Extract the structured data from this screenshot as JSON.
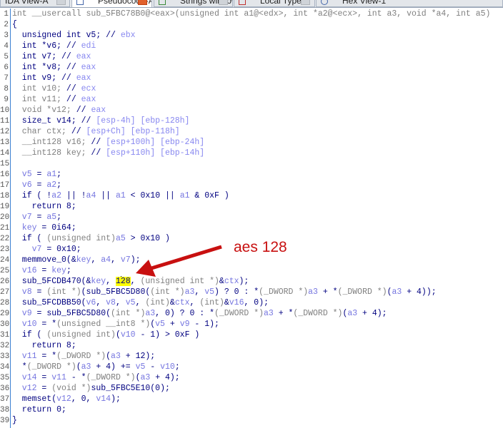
{
  "tabs": [
    {
      "label": "IDA View-A",
      "active": false
    },
    {
      "label": "Pseudocode-A",
      "active": true
    },
    {
      "label": "Strings window",
      "active": false
    },
    {
      "label": "Local Types",
      "active": false
    },
    {
      "label": "Hex View-1",
      "active": false
    }
  ],
  "annotation": {
    "label": "aes 128",
    "color": "#c81010"
  },
  "code": [
    [
      [
        "g",
        "int __usercall sub_5FBC78B0@<eax>(unsigned int a1@<edx>, int *a2@<ecx>, int a3, void *a4, int a5)"
      ]
    ],
    [
      [
        "k",
        "{"
      ]
    ],
    [
      [
        "k",
        "  unsigned int v5; // "
      ],
      [
        "c",
        "ebx"
      ]
    ],
    [
      [
        "k",
        "  int *v6; // "
      ],
      [
        "c",
        "edi"
      ]
    ],
    [
      [
        "k",
        "  int v7; // "
      ],
      [
        "c",
        "eax"
      ]
    ],
    [
      [
        "k",
        "  int *v8; // "
      ],
      [
        "c",
        "eax"
      ]
    ],
    [
      [
        "k",
        "  int v9; // "
      ],
      [
        "c",
        "eax"
      ]
    ],
    [
      [
        "g",
        "  int v10; "
      ],
      [
        "k",
        "// "
      ],
      [
        "c",
        "ecx"
      ]
    ],
    [
      [
        "g",
        "  int v11; "
      ],
      [
        "k",
        "// "
      ],
      [
        "c",
        "eax"
      ]
    ],
    [
      [
        "g",
        "  void *v12; "
      ],
      [
        "k",
        "// "
      ],
      [
        "c",
        "eax"
      ]
    ],
    [
      [
        "k",
        "  size_t v14; // "
      ],
      [
        "c",
        "[esp-4h] [ebp-128h]"
      ]
    ],
    [
      [
        "g",
        "  char ctx; "
      ],
      [
        "k",
        "// "
      ],
      [
        "c",
        "[esp+Ch] [ebp-118h]"
      ]
    ],
    [
      [
        "g",
        "  __int128 v16; "
      ],
      [
        "k",
        "// "
      ],
      [
        "c",
        "[esp+100h] [ebp-24h]"
      ]
    ],
    [
      [
        "g",
        "  __int128 key; "
      ],
      [
        "k",
        "// "
      ],
      [
        "c",
        "[esp+110h] [ebp-14h]"
      ]
    ],
    [],
    [
      [
        "v",
        "  v5"
      ],
      [
        "k",
        " = "
      ],
      [
        "v",
        "a1"
      ],
      [
        "k",
        ";"
      ]
    ],
    [
      [
        "v",
        "  v6"
      ],
      [
        "k",
        " = "
      ],
      [
        "v",
        "a2"
      ],
      [
        "k",
        ";"
      ]
    ],
    [
      [
        "k",
        "  if ( !"
      ],
      [
        "v",
        "a2"
      ],
      [
        "k",
        " || !"
      ],
      [
        "v",
        "a4"
      ],
      [
        "k",
        " || "
      ],
      [
        "v",
        "a1"
      ],
      [
        "k",
        " < 0x10 || "
      ],
      [
        "v",
        "a1"
      ],
      [
        "k",
        " & 0xF )"
      ]
    ],
    [
      [
        "k",
        "    return 8;"
      ]
    ],
    [
      [
        "v",
        "  v7"
      ],
      [
        "k",
        " = "
      ],
      [
        "v",
        "a5"
      ],
      [
        "k",
        ";"
      ]
    ],
    [
      [
        "v",
        "  key"
      ],
      [
        "k",
        " = 0i64;"
      ]
    ],
    [
      [
        "k",
        "  if ( "
      ],
      [
        "g",
        "(unsigned int)"
      ],
      [
        "v",
        "a5"
      ],
      [
        "k",
        " > 0x10 )"
      ]
    ],
    [
      [
        "v",
        "    v7"
      ],
      [
        "k",
        " = 0x10;"
      ]
    ],
    [
      [
        "k",
        "  memmove_0(&"
      ],
      [
        "v",
        "key"
      ],
      [
        "k",
        ", "
      ],
      [
        "v",
        "a4"
      ],
      [
        "k",
        ", "
      ],
      [
        "v",
        "v7"
      ],
      [
        "k",
        ");"
      ]
    ],
    [
      [
        "v",
        "  v16"
      ],
      [
        "k",
        " = "
      ],
      [
        "v",
        "key"
      ],
      [
        "k",
        ";"
      ]
    ],
    [
      [
        "k",
        "  sub_5FCDB470(&"
      ],
      [
        "v",
        "key"
      ],
      [
        "k",
        ", "
      ],
      [
        "h",
        "1"
      ],
      [
        "cur",
        ""
      ],
      [
        "h",
        "28"
      ],
      [
        "k",
        ", "
      ],
      [
        "g",
        "(unsigned int *)"
      ],
      [
        "k",
        "&"
      ],
      [
        "v",
        "ctx"
      ],
      [
        "k",
        ");"
      ]
    ],
    [
      [
        "v",
        "  v8"
      ],
      [
        "k",
        " = "
      ],
      [
        "g",
        "(int *)"
      ],
      [
        "k",
        "(sub_5FBC5D80("
      ],
      [
        "g",
        "(int *)"
      ],
      [
        "v",
        "a3"
      ],
      [
        "k",
        ", "
      ],
      [
        "v",
        "v5"
      ],
      [
        "k",
        ") ? 0 : *"
      ],
      [
        "g",
        "(_DWORD *)"
      ],
      [
        "v",
        "a3"
      ],
      [
        "k",
        " + *"
      ],
      [
        "g",
        "(_DWORD *)"
      ],
      [
        "k",
        "("
      ],
      [
        "v",
        "a3"
      ],
      [
        "k",
        " + 4));"
      ]
    ],
    [
      [
        "k",
        "  sub_5FCDBB50("
      ],
      [
        "v",
        "v6"
      ],
      [
        "k",
        ", "
      ],
      [
        "v",
        "v8"
      ],
      [
        "k",
        ", "
      ],
      [
        "v",
        "v5"
      ],
      [
        "k",
        ", "
      ],
      [
        "g",
        "(int)"
      ],
      [
        "k",
        "&"
      ],
      [
        "v",
        "ctx"
      ],
      [
        "k",
        ", "
      ],
      [
        "g",
        "(int)"
      ],
      [
        "k",
        "&"
      ],
      [
        "v",
        "v16"
      ],
      [
        "k",
        ", 0);"
      ]
    ],
    [
      [
        "v",
        "  v9"
      ],
      [
        "k",
        " = sub_5FBC5D80("
      ],
      [
        "g",
        "(int *)"
      ],
      [
        "v",
        "a3"
      ],
      [
        "k",
        ", 0) ? 0 : *"
      ],
      [
        "g",
        "(_DWORD *)"
      ],
      [
        "v",
        "a3"
      ],
      [
        "k",
        " + *"
      ],
      [
        "g",
        "(_DWORD *)"
      ],
      [
        "k",
        "("
      ],
      [
        "v",
        "a3"
      ],
      [
        "k",
        " + 4);"
      ]
    ],
    [
      [
        "v",
        "  v10"
      ],
      [
        "k",
        " = *"
      ],
      [
        "g",
        "(unsigned __int8 *)"
      ],
      [
        "k",
        "("
      ],
      [
        "v",
        "v5"
      ],
      [
        "k",
        " + "
      ],
      [
        "v",
        "v9"
      ],
      [
        "k",
        " - 1);"
      ]
    ],
    [
      [
        "k",
        "  if ( "
      ],
      [
        "g",
        "(unsigned int)"
      ],
      [
        "k",
        "("
      ],
      [
        "v",
        "v10"
      ],
      [
        "k",
        " - 1) > 0xF )"
      ]
    ],
    [
      [
        "k",
        "    return 8;"
      ]
    ],
    [
      [
        "v",
        "  v11"
      ],
      [
        "k",
        " = *"
      ],
      [
        "g",
        "(_DWORD *)"
      ],
      [
        "k",
        "("
      ],
      [
        "v",
        "a3"
      ],
      [
        "k",
        " + 12);"
      ]
    ],
    [
      [
        "k",
        "  *"
      ],
      [
        "g",
        "(_DWORD *)"
      ],
      [
        "k",
        "("
      ],
      [
        "v",
        "a3"
      ],
      [
        "k",
        " + 4) += "
      ],
      [
        "v",
        "v5"
      ],
      [
        "k",
        " - "
      ],
      [
        "v",
        "v10"
      ],
      [
        "k",
        ";"
      ]
    ],
    [
      [
        "v",
        "  v14"
      ],
      [
        "k",
        " = "
      ],
      [
        "v",
        "v11"
      ],
      [
        "k",
        " - *"
      ],
      [
        "g",
        "(_DWORD *)"
      ],
      [
        "k",
        "("
      ],
      [
        "v",
        "a3"
      ],
      [
        "k",
        " + 4);"
      ]
    ],
    [
      [
        "v",
        "  v12"
      ],
      [
        "k",
        " = "
      ],
      [
        "g",
        "(void *)"
      ],
      [
        "k",
        "sub_5FBC5E10(0);"
      ]
    ],
    [
      [
        "k",
        "  memset("
      ],
      [
        "v",
        "v12"
      ],
      [
        "k",
        ", 0, "
      ],
      [
        "v",
        "v14"
      ],
      [
        "k",
        ");"
      ]
    ],
    [
      [
        "k",
        "  return 0;"
      ]
    ],
    [
      [
        "k",
        "}"
      ]
    ]
  ]
}
